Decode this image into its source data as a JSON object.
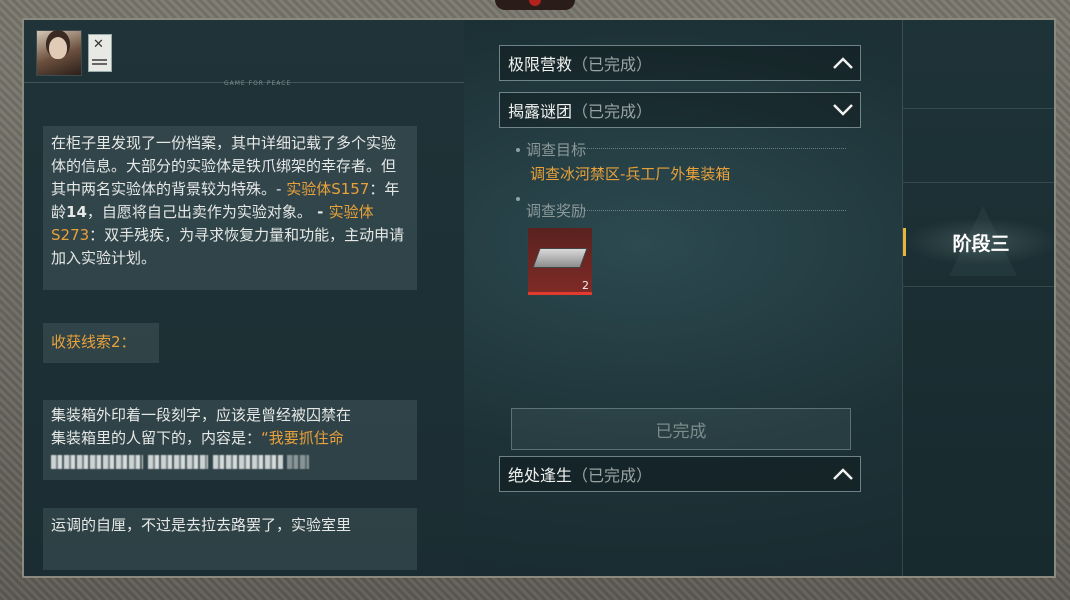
{
  "header": {
    "strip_caption": "GAME FOR PEACE"
  },
  "left_panel": {
    "box1": {
      "intro": "在柜子里发现了一份档案，其中详细记载了多个实验体的信息。大部分的实验体是铁爪绑架的幸存者。但其中两名实验体的背景较为特殊。- ",
      "subject1_name": "实验体S157",
      "subject1_desc_a": "：年龄",
      "subject1_age": "14",
      "subject1_desc_b": "，自愿将自己出卖作为实验对象。",
      "dash2": " - ",
      "subject2_name": "实验体S273",
      "subject2_desc": "：双手残疾，为寻求恢复力量和功能，主动申请加入实验计划",
      "end": "。"
    },
    "clue_label": "收获线索2：",
    "box3": {
      "line1": "集装箱外印着一段刻字，应该是曾经被囚禁在",
      "line2_a": "集装箱里的人留下的，内容是：",
      "line2_highlight": "“我要抓住命"
    },
    "box4": {
      "line1": "运调的自厘，不过是去拉去路罢了，实验室里"
    }
  },
  "quests": [
    {
      "name": "极限营救",
      "status": "（已完成）",
      "expanded": true
    },
    {
      "name": "揭露谜团",
      "status": "（已完成）",
      "expanded": false
    },
    {
      "name": "绝处逢生",
      "status": "（已完成）",
      "expanded": true
    }
  ],
  "quest_detail": {
    "target_label": "调查目标",
    "target_text": "调查冰河禁区-兵工厂外集装箱",
    "reward_label": "调查奖励",
    "reward_count": "2",
    "complete_button": "已完成"
  },
  "stage": {
    "label": "阶段三"
  },
  "colors": {
    "highlight": "#e9a13a",
    "stage_marker": "#e7b73a",
    "reward_border": "#e33a2f"
  }
}
